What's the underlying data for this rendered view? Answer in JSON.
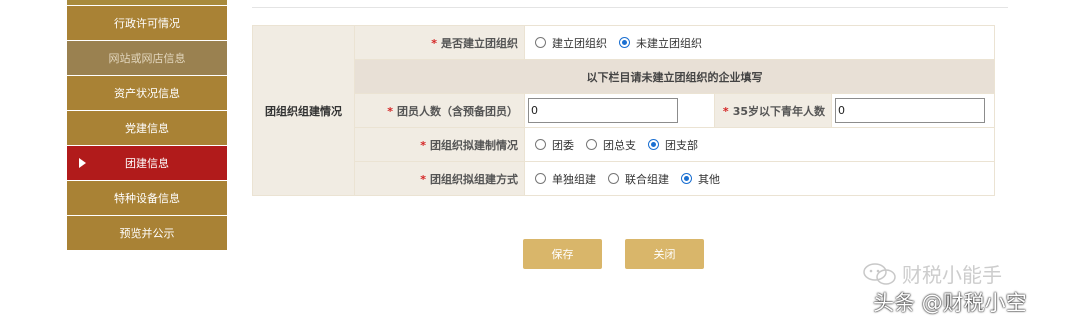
{
  "sidebar": {
    "items": [
      {
        "label": "行政许可情况"
      },
      {
        "label": "网站或网店信息"
      },
      {
        "label": "资产状况信息"
      },
      {
        "label": "党建信息"
      },
      {
        "label": "团建信息"
      },
      {
        "label": "特种设备信息"
      },
      {
        "label": "预览并公示"
      }
    ],
    "active_index": 4
  },
  "form": {
    "group_label": "团组织组建情况",
    "q_establish": {
      "label": "是否建立团组织",
      "options": [
        "建立团组织",
        "未建立团组织"
      ],
      "selected": "未建立团组织"
    },
    "notice": "以下栏目请未建立团组织的企业填写",
    "members": {
      "label": "团员人数（含预备团员）",
      "value": "0"
    },
    "youth": {
      "label": "35岁以下青年人数",
      "value": "0"
    },
    "q_plan": {
      "label": "团组织拟建制情况",
      "options": [
        "团委",
        "团总支",
        "团支部"
      ],
      "selected": "团支部"
    },
    "q_method": {
      "label": "团组织拟组建方式",
      "options": [
        "单独组建",
        "联合组建",
        "其他"
      ],
      "selected": "其他"
    },
    "required_mark": "*"
  },
  "buttons": {
    "save": "保存",
    "close": "关闭"
  },
  "watermark": {
    "line1": "财税小能手",
    "line2": "头条 @财税小空"
  },
  "colors": {
    "sidebar": "#a98235",
    "sidebar_active": "#b11b1b",
    "button": "#d9b66a",
    "radio_checked": "#1a6fd1"
  }
}
